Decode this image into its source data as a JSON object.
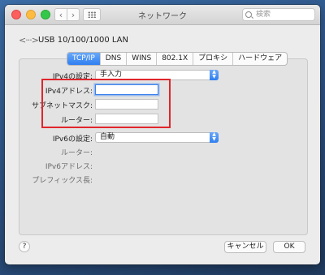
{
  "window": {
    "title": "ネットワーク"
  },
  "toolbar": {
    "back_icon": "‹",
    "forward_icon": "›",
    "search_placeholder": "検索"
  },
  "device": {
    "icon": "<···>",
    "label": "USB 10/100/1000 LAN"
  },
  "tabs": [
    {
      "label": "TCP/IP",
      "active": true
    },
    {
      "label": "DNS",
      "active": false
    },
    {
      "label": "WINS",
      "active": false
    },
    {
      "label": "802.1X",
      "active": false
    },
    {
      "label": "プロキシ",
      "active": false
    },
    {
      "label": "ハードウェア",
      "active": false
    }
  ],
  "ipv4": {
    "config_label": "IPv4の設定:",
    "config_value": "手入力",
    "address_label": "IPv4アドレス:",
    "address_value": "",
    "subnet_label": "サブネットマスク:",
    "subnet_value": "",
    "router_label": "ルーター:",
    "router_value": ""
  },
  "ipv6": {
    "config_label": "IPv6の設定:",
    "config_value": "自動",
    "router_label": "ルーター:",
    "address_label": "IPv6アドレス:",
    "prefix_label": "プレフィックス長:"
  },
  "footer": {
    "help": "?",
    "cancel": "キャンセル",
    "ok": "OK"
  },
  "colors": {
    "accent": "#2f7ff1",
    "highlight": "#e0262b"
  }
}
